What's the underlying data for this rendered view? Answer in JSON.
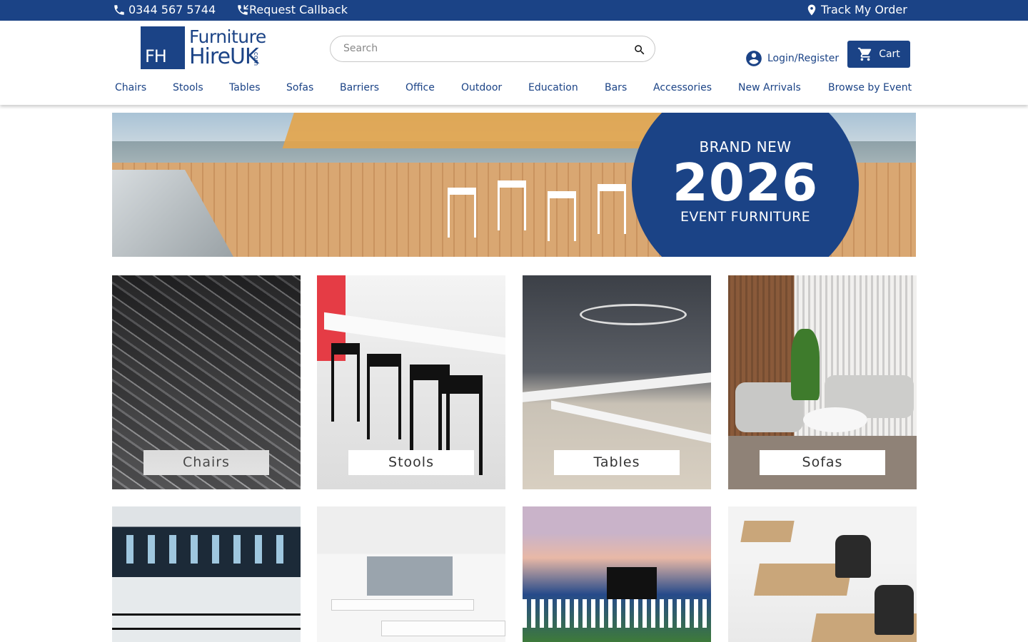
{
  "topbar": {
    "phone": "0344 567 5744",
    "callback": "Request Callback",
    "track": "Track My Order"
  },
  "header": {
    "logo_line1": "Furniture",
    "logo_line2": "HireUK",
    "logo_suffix": ".com",
    "logo_mark": "FH",
    "search_placeholder": "Search",
    "login": "Login/Register",
    "cart": "Cart"
  },
  "nav": [
    "Chairs",
    "Stools",
    "Tables",
    "Sofas",
    "Barriers",
    "Office",
    "Outdoor",
    "Education",
    "Bars",
    "Accessories",
    "New Arrivals",
    "Browse by Event"
  ],
  "hero": {
    "line1": "BRAND NEW",
    "line2": "2026",
    "line3": "EVENT FURNITURE"
  },
  "tiles": [
    "Chairs",
    "Stools",
    "Tables",
    "Sofas"
  ],
  "colors": {
    "brand": "#1b4386",
    "white": "#ffffff"
  }
}
